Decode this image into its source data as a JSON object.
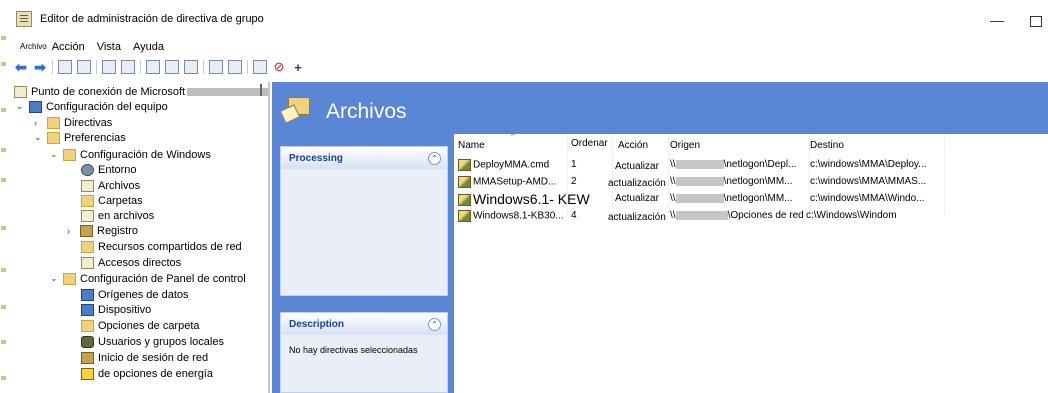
{
  "window": {
    "title": "Editor de administración de directiva de grupo",
    "minimize_glyph": "—"
  },
  "menu": [
    "Archivo",
    "Acción",
    "Vista",
    "Ayuda"
  ],
  "tree": {
    "root_label": "Punto de conexión de Microsoft",
    "items": [
      {
        "label": "Configuración del equipo",
        "chevron": "⌄"
      },
      {
        "label": "Directivas",
        "chevron": "›"
      },
      {
        "label": "Preferencias",
        "chevron": "⌄"
      },
      {
        "label": "Configuración de Windows",
        "chevron": "⌄"
      },
      {
        "label": "Entorno",
        "chevron": ""
      },
      {
        "label": "Archivos",
        "chevron": ""
      },
      {
        "label": "Carpetas",
        "chevron": ""
      },
      {
        "label": "en archivos",
        "chevron": ""
      },
      {
        "label": "Registro",
        "chevron": "›"
      },
      {
        "label": "Recursos compartidos de red",
        "chevron": ""
      },
      {
        "label": "Accesos directos",
        "chevron": ""
      },
      {
        "label": "Configuración de Panel de control",
        "chevron": "⌄"
      },
      {
        "label": "Orígenes de datos",
        "chevron": ""
      },
      {
        "label": "Dispositivo",
        "chevron": ""
      },
      {
        "label": "Opciones de carpeta",
        "chevron": ""
      },
      {
        "label": "Usuarios y grupos locales",
        "chevron": ""
      },
      {
        "label": "Inicio de sesión de red",
        "chevron": ""
      },
      {
        "label": "de opciones de energía",
        "chevron": ""
      }
    ]
  },
  "main": {
    "title": "Archivos",
    "processing_title": "Processing",
    "description_title": "Description",
    "description_text": "No hay directivas seleccionadas",
    "collapse_glyph": "⌃",
    "columns": [
      "Name",
      "Ordenar",
      "Acción",
      "Origen",
      "Destino"
    ],
    "rows": [
      {
        "name": "DeployMMA.cmd",
        "order": "1",
        "action": "Actualizar",
        "origin_suffix": "\\netlogon\\Depl...",
        "dest": "c:\\windows\\MMA\\Deploy..."
      },
      {
        "name": "MMASetup-AMD...",
        "order": "2",
        "action": "actualización",
        "origin_suffix": "\\netlogon\\MM...",
        "dest": "c:\\windows\\MMA\\MMAS..."
      },
      {
        "name": "Windows6.1- KEW",
        "order": "",
        "action": "Actualizar",
        "origin_suffix": "\\netlogon\\MM...",
        "dest": "c:\\windows\\MMA\\Windo..."
      },
      {
        "name": "Windows8.1-KB30...",
        "order": "4",
        "action": "actualización",
        "origin_suffix": "\\Opciones de red",
        "dest": "c:\\Windows\\Windom"
      }
    ],
    "origin_prefix": "\\\\"
  }
}
